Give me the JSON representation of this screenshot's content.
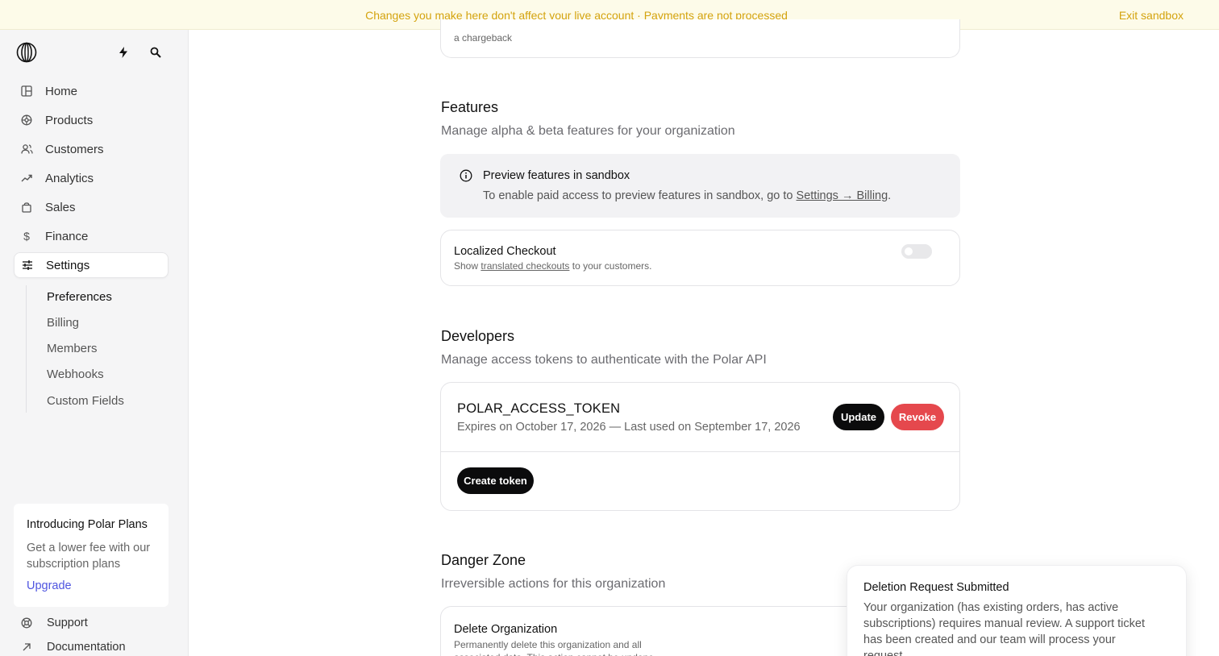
{
  "banner": {
    "message": "Changes you make here don't affect your live account · Payments are not processed",
    "exit_label": "Exit sandbox"
  },
  "sidebar": {
    "icons": [
      "polar-logo-icon",
      "lightning-icon",
      "search-icon"
    ],
    "items": [
      {
        "label": "Home",
        "icon": "home-icon"
      },
      {
        "label": "Products",
        "icon": "products-icon"
      },
      {
        "label": "Customers",
        "icon": "customers-icon"
      },
      {
        "label": "Analytics",
        "icon": "analytics-icon"
      },
      {
        "label": "Sales",
        "icon": "sales-icon"
      },
      {
        "label": "Finance",
        "icon": "dollar-icon"
      },
      {
        "label": "Settings",
        "icon": "settings-icon",
        "active": true
      }
    ],
    "subnav": [
      "Preferences",
      "Billing",
      "Members",
      "Webhooks",
      "Custom Fields"
    ],
    "promo": {
      "title": "Introducing Polar Plans",
      "text": "Get a lower fee with our subscription plans",
      "link": "Upgrade"
    },
    "footer": [
      {
        "label": "Support",
        "icon": "support-icon"
      },
      {
        "label": "Documentation",
        "icon": "external-arrow-icon"
      }
    ]
  },
  "main": {
    "top_card_text": "a chargeback",
    "features": {
      "title": "Features",
      "subtitle": "Manage alpha & beta features for your organization",
      "info_title": "Preview features in sandbox",
      "info_text": "To enable paid access to preview features in sandbox, go to ",
      "info_link": "Settings → Billing",
      "info_suffix": ".",
      "localized_title": "Localized Checkout",
      "localized_prefix": "Show ",
      "localized_link": "translated checkouts",
      "localized_suffix": " to your customers.",
      "localized_enabled": false
    },
    "developers": {
      "title": "Developers",
      "subtitle": "Manage access tokens to authenticate with the Polar API",
      "token_name": "POLAR_ACCESS_TOKEN",
      "token_meta": "Expires on October 17, 2026 — Last used on September 17, 2026",
      "update_label": "Update",
      "revoke_label": "Revoke",
      "create_label": "Create token"
    },
    "danger": {
      "title": "Danger Zone",
      "subtitle": "Irreversible actions for this organization",
      "delete_title": "Delete Organization",
      "delete_desc": "Permanently delete this organization and all associated data. This action cannot be undone."
    }
  },
  "toast": {
    "title": "Deletion Request Submitted",
    "text": "Your organization (has existing orders, has active subscriptions) requires manual review. A support ticket has been created and our team will process your request."
  },
  "colors": {
    "banner_text": "#d4a30e",
    "accent_link": "#4f55e0",
    "revoke": "#e5484d"
  }
}
